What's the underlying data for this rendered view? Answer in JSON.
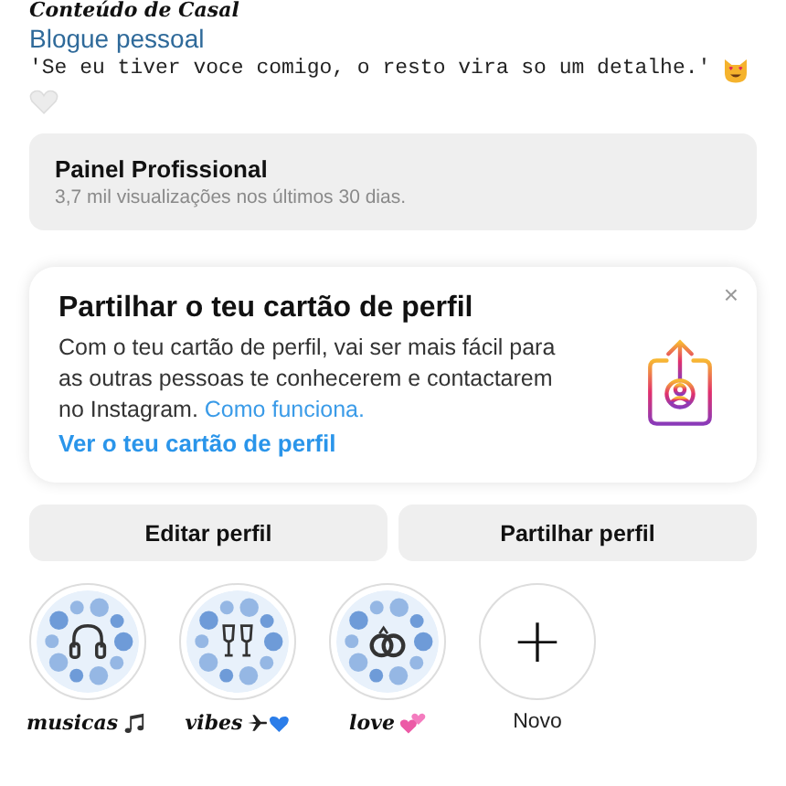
{
  "profile": {
    "name": "Conteúdo de Casal",
    "category": "Blogue pessoal",
    "bio": "'Se eu tiver voce comigo, o resto vira so um detalhe.'"
  },
  "dashboard": {
    "title": "Painel Profissional",
    "subtitle": "3,7 mil visualizações nos últimos 30 dias."
  },
  "card_prompt": {
    "title": "Partilhar o teu cartão de perfil",
    "text": "Com o teu cartão de perfil, vai ser mais fácil para as outras pessoas te conhecerem e contactarem no Instagram.",
    "link": "Como funciona.",
    "action": "Ver o teu cartão de perfil",
    "close": "×"
  },
  "buttons": [
    "Editar perfil",
    "Partilhar perfil"
  ],
  "highlights": [
    {
      "kind": "cover",
      "label": "musicas"
    },
    {
      "kind": "cover",
      "label": "vibes"
    },
    {
      "kind": "cover",
      "label": "love"
    },
    {
      "kind": "new",
      "symbol": "+",
      "label": "Novo"
    }
  ]
}
